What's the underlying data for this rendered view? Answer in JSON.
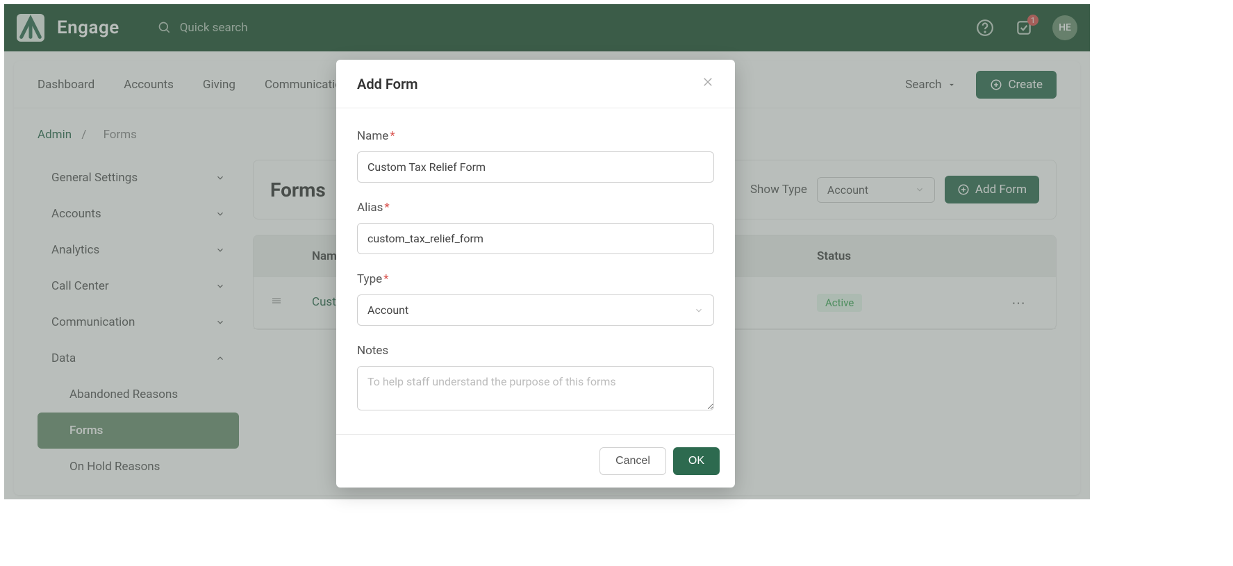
{
  "app": {
    "name": "Engage",
    "search_placeholder": "Quick search",
    "badge_count": "1",
    "avatar": "HE"
  },
  "nav": {
    "links": [
      "Dashboard",
      "Accounts",
      "Giving",
      "Communication"
    ],
    "search_label": "Search",
    "create_label": "Create"
  },
  "breadcrumb": {
    "root": "Admin",
    "current": "Forms"
  },
  "sidebar": {
    "items": [
      {
        "label": "General Settings",
        "open": false
      },
      {
        "label": "Accounts",
        "open": false
      },
      {
        "label": "Analytics",
        "open": false
      },
      {
        "label": "Call Center",
        "open": false
      },
      {
        "label": "Communication",
        "open": false
      },
      {
        "label": "Data",
        "open": true
      }
    ],
    "subs": [
      {
        "label": "Abandoned Reasons",
        "active": false
      },
      {
        "label": "Forms",
        "active": true
      },
      {
        "label": "On Hold Reasons",
        "active": false
      }
    ]
  },
  "panel": {
    "title": "Forms",
    "show_type_label": "Show Type",
    "show_type_value": "Account",
    "add_btn": "Add Form",
    "columns": {
      "name": "Name",
      "status": "Status"
    },
    "rows": [
      {
        "name": "Custom Tax Relief Form",
        "status": "Active"
      }
    ]
  },
  "modal": {
    "title": "Add Form",
    "name_label": "Name",
    "name_value": "Custom Tax Relief Form",
    "alias_label": "Alias",
    "alias_value": "custom_tax_relief_form",
    "type_label": "Type",
    "type_value": "Account",
    "notes_label": "Notes",
    "notes_placeholder": "To help staff understand the purpose of this forms",
    "cancel": "Cancel",
    "ok": "OK"
  }
}
